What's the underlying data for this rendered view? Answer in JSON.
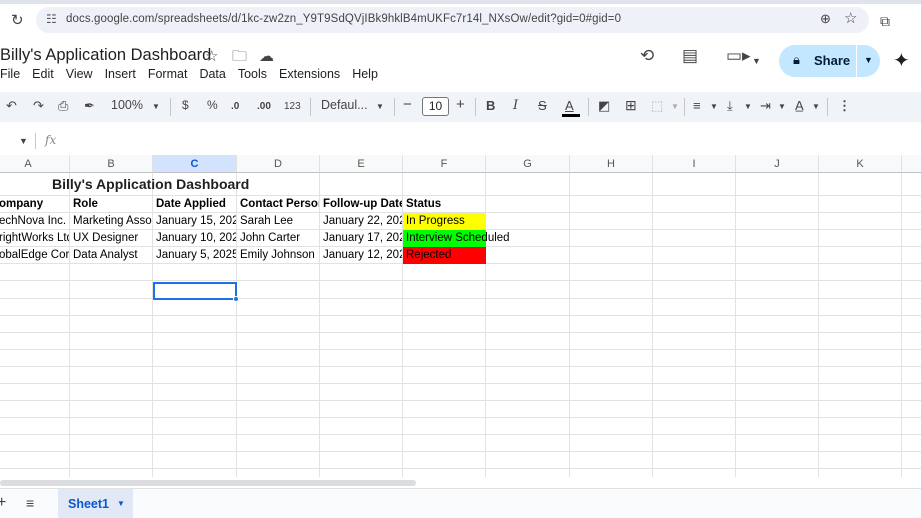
{
  "browser": {
    "url": "docs.google.com/spreadsheets/d/1kc-zw2zn_Y9T9SdQVjIBk9hklB4mUKFc7r14l_NXsOw/edit?gid=0#gid=0"
  },
  "doc": {
    "title": "Billy's Application Dashboard",
    "menu": [
      "File",
      "Edit",
      "View",
      "Insert",
      "Format",
      "Data",
      "Tools",
      "Extensions",
      "Help"
    ],
    "share_label": "Share"
  },
  "toolbar": {
    "zoom": "100%",
    "currency": "$",
    "percent": "%",
    "decimal_decrease": ".0",
    "decimal_increase": ".00",
    "number_format": "123",
    "font": "Defaul...",
    "font_size": "10",
    "bold": "B",
    "italic": "I",
    "strike": "S",
    "text_color": "A"
  },
  "grid": {
    "columns": [
      "A",
      "B",
      "C",
      "D",
      "E",
      "F",
      "G",
      "H",
      "I",
      "J",
      "K"
    ],
    "selected_column": "C",
    "dashboard_title": "Billy's Application Dashboard",
    "headers": {
      "company": "ompany",
      "role": "Role",
      "date_applied": "Date Applied",
      "contact_person": "Contact Person",
      "follow_up_date": "Follow-up Date",
      "status": "Status"
    },
    "rows": [
      {
        "company": "echNova Inc.",
        "role": "Marketing Assoc",
        "date_applied": "January 15, 202",
        "contact": "Sarah Lee",
        "follow_up": "January 22, 202",
        "status": "In Progress",
        "status_color": "#ffff00"
      },
      {
        "company": "rightWorks Ltd.",
        "role": "UX Designer",
        "date_applied": "January 10, 202",
        "contact": "John Carter",
        "follow_up": "January 17, 202",
        "status": "Interview Scheduled",
        "status_color": "#00ff00"
      },
      {
        "company": "obalEdge Cor",
        "role": "Data Analyst",
        "date_applied": "January 5, 2025",
        "contact": "Emily Johnson",
        "follow_up": "January 12, 202",
        "status": "Rejected",
        "status_color": "#ff0000"
      }
    ]
  },
  "sheets": {
    "active": "Sheet1"
  }
}
